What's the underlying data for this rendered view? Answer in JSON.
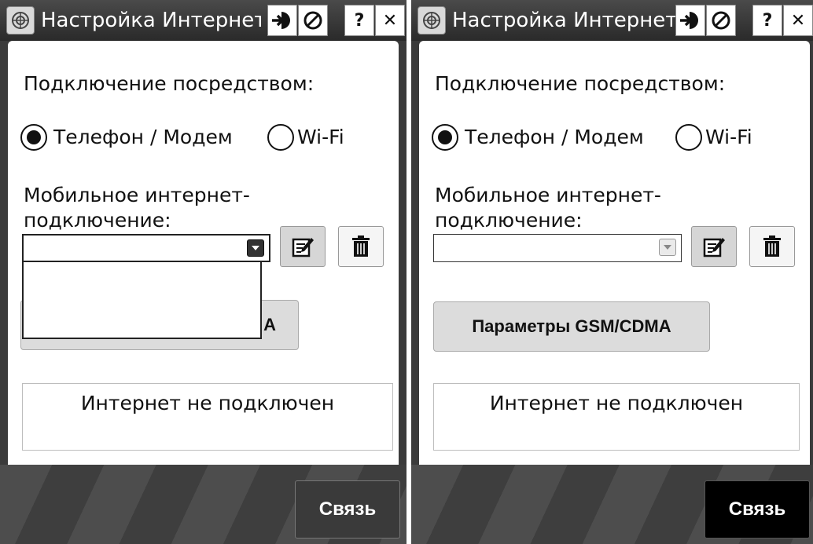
{
  "screens": [
    {
      "title": "Настройка Интернета",
      "connect_via_label": "Подключение посредством:",
      "radio_phone_label": "Телефон / Модем",
      "radio_wifi_label": "Wi-Fi",
      "radio_phone_checked": true,
      "mobile_label_line1": "Мобильное интернет-",
      "mobile_label_line2": "подключение:",
      "mobile_value": "",
      "dropdown_open": true,
      "gsm_button_label_visible": "А",
      "status_text": "Интернет не подключен",
      "connect_label": "Связь"
    },
    {
      "title": "Настройка Интернета",
      "connect_via_label": "Подключение посредством:",
      "radio_phone_label": "Телефон / Модем",
      "radio_wifi_label": "Wi-Fi",
      "radio_phone_checked": true,
      "mobile_label_line1": "Мобильное интернет-",
      "mobile_label_line2": "подключение:",
      "mobile_value": "",
      "dropdown_open": false,
      "gsm_button_label": "Параметры GSM/CDMA",
      "status_text": "Интернет не подключен",
      "connect_label": "Связь"
    }
  ],
  "icons": {
    "app": "rosette-icon",
    "ok": "enter-arrow-icon",
    "cancel": "no-entry-icon",
    "help": "question-icon",
    "close": "close-icon",
    "edit": "edit-note-icon",
    "delete": "trash-icon"
  },
  "help_glyph": "?",
  "close_glyph": "✕"
}
